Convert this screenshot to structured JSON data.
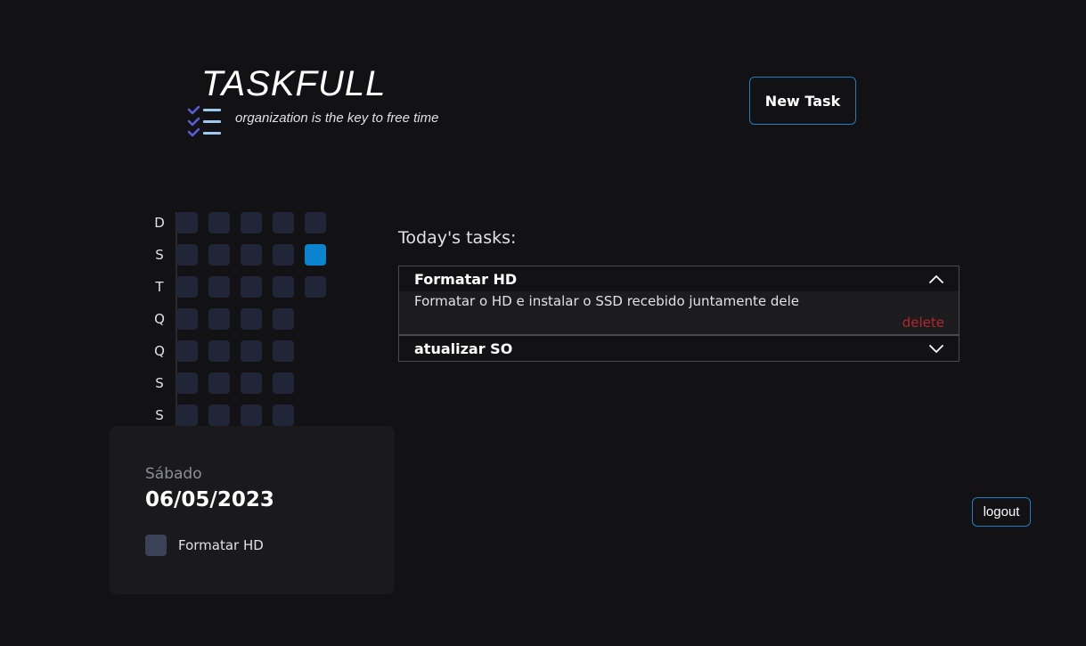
{
  "header": {
    "title": "TASKFULL",
    "tagline": "organization is the key to free time",
    "logo_icon": "checklist-icon",
    "new_task_label": "New Task"
  },
  "habit_grid": {
    "day_labels": [
      "D",
      "S",
      "T",
      "Q",
      "Q",
      "S",
      "S"
    ],
    "columns": [
      {
        "cells": [
          {
            "day": "D",
            "done": false
          },
          {
            "day": "S",
            "done": false
          },
          {
            "day": "T",
            "done": false
          },
          {
            "day": "Q",
            "done": false
          },
          {
            "day": "Q",
            "done": false
          },
          {
            "day": "S",
            "done": false
          },
          {
            "day": "S",
            "done": false
          }
        ]
      },
      {
        "cells": [
          {
            "day": "D",
            "done": false
          },
          {
            "day": "S",
            "done": false
          },
          {
            "day": "T",
            "done": false
          },
          {
            "day": "Q",
            "done": false
          },
          {
            "day": "Q",
            "done": false
          },
          {
            "day": "S",
            "done": false
          },
          {
            "day": "S",
            "done": false
          }
        ]
      },
      {
        "cells": [
          {
            "day": "D",
            "done": false
          },
          {
            "day": "S",
            "done": false
          },
          {
            "day": "T",
            "done": false
          },
          {
            "day": "Q",
            "done": false
          },
          {
            "day": "Q",
            "done": false
          },
          {
            "day": "S",
            "done": false
          },
          {
            "day": "S",
            "done": false
          }
        ]
      },
      {
        "cells": [
          {
            "day": "D",
            "done": false
          },
          {
            "day": "S",
            "done": false
          },
          {
            "day": "T",
            "done": false
          },
          {
            "day": "Q",
            "done": false
          },
          {
            "day": "Q",
            "done": false
          },
          {
            "day": "S",
            "done": false
          },
          {
            "day": "S",
            "done": false
          }
        ]
      },
      {
        "cells": [
          {
            "day": "D",
            "done": false
          },
          {
            "day": "S",
            "done": true
          },
          {
            "day": "T",
            "done": false
          }
        ]
      }
    ],
    "active_color": "#0a84cf",
    "inactive_color": "#202637"
  },
  "summary": {
    "weekday": "Sábado",
    "date": "06/05/2023",
    "tasks": [
      {
        "label": "Formatar HD",
        "checked": false
      }
    ]
  },
  "tasks_panel": {
    "heading": "Today's tasks:",
    "tasks": [
      {
        "title": "Formatar HD",
        "description": "Formatar o HD e instalar o SSD recebido juntamente dele",
        "delete_label": "delete",
        "expanded": true
      },
      {
        "title": "atualizar SO",
        "expanded": false
      }
    ]
  },
  "logout_label": "logout",
  "colors": {
    "background": "#121214",
    "accent": "#1f7cc0",
    "danger": "#b3262a"
  }
}
